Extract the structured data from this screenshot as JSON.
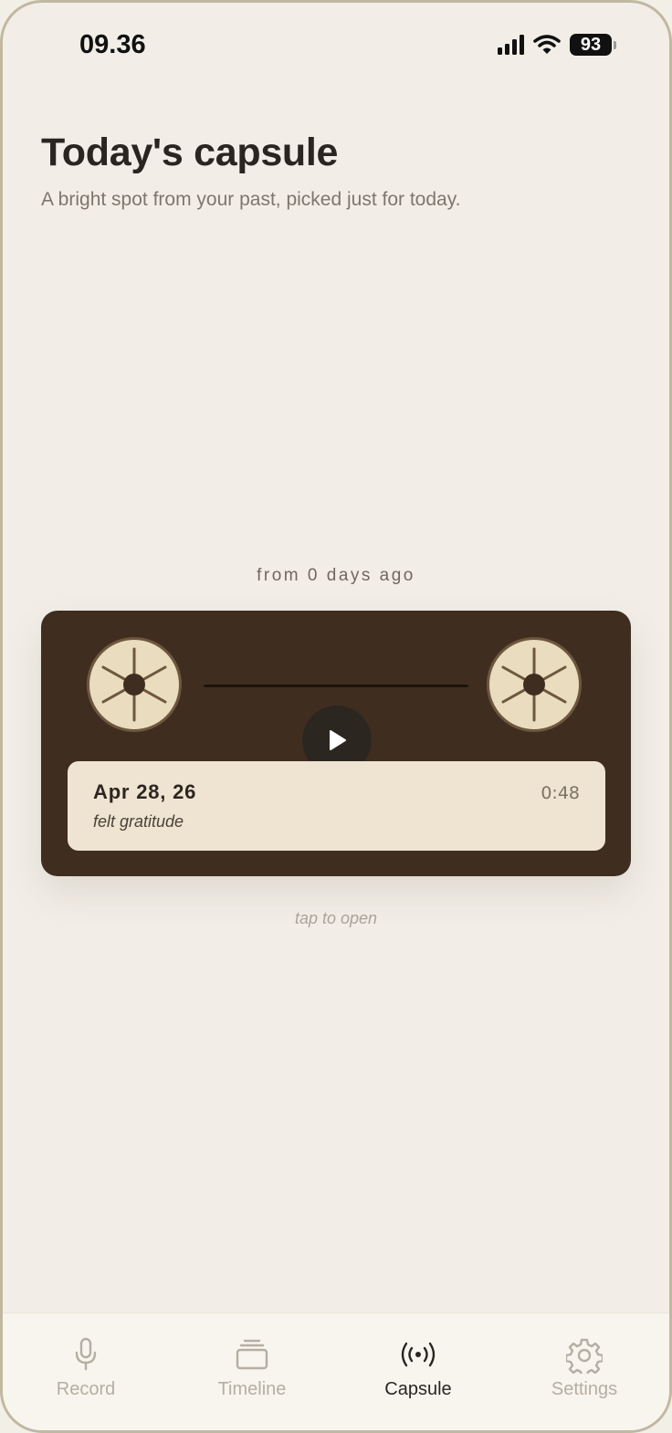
{
  "status_bar": {
    "time": "09.36",
    "battery": "93"
  },
  "header": {
    "title": "Today's capsule",
    "subtitle": "A bright spot from your past, picked just for today."
  },
  "capsule": {
    "from_label": "from 0 days ago",
    "date": "Apr 28, 26",
    "note": "felt gratitude",
    "duration": "0:48",
    "hint": "tap to open"
  },
  "tabs": [
    {
      "label": "Record",
      "icon": "microphone-icon",
      "active": false
    },
    {
      "label": "Timeline",
      "icon": "stack-icon",
      "active": false
    },
    {
      "label": "Capsule",
      "icon": "broadcast-icon",
      "active": true
    },
    {
      "label": "Settings",
      "icon": "gear-icon",
      "active": false
    }
  ],
  "colors": {
    "background": "#f2eee7",
    "cassette": "#3f2e20",
    "reel": "#eadcbe",
    "card": "#efe4d1",
    "active_tab": "#2a2520",
    "inactive_tab": "#b5aea3"
  }
}
